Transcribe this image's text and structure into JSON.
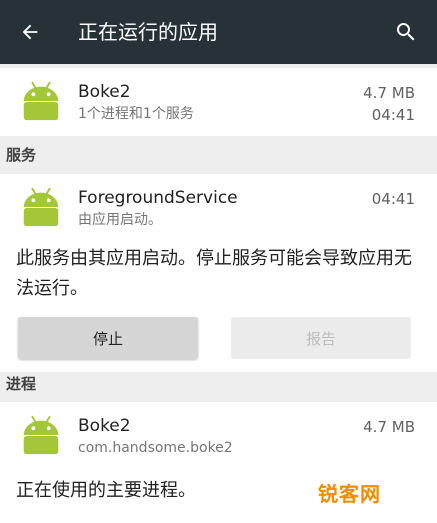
{
  "toolbar": {
    "title": "正在运行的应用",
    "back_icon": "arrow-left-icon",
    "search_icon": "search-icon",
    "background": "#263238"
  },
  "app_summary": {
    "name": "Boke2",
    "subtitle": "1个进程和1个服务",
    "size": "4.7 MB",
    "time": "04:41",
    "icon": "android-icon"
  },
  "services_section": {
    "header": "服务",
    "item": {
      "name": "ForegroundService",
      "subtitle": "由应用启动。",
      "time": "04:41",
      "icon": "android-icon"
    },
    "description": "此服务由其应用启动。停止服务可能会导致应用无法运行。",
    "stop_label": "停止",
    "report_label": "报告"
  },
  "processes_section": {
    "header": "进程",
    "item": {
      "name": "Boke2",
      "subtitle": "com.handsome.boke2",
      "size": "4.7 MB",
      "icon": "android-icon"
    },
    "description": "正在使用的主要进程。"
  },
  "watermark": {
    "text": "锐客网",
    "color": "#f28c00"
  },
  "colors": {
    "android_green": "#a4c639",
    "background": "#eeeeee"
  }
}
